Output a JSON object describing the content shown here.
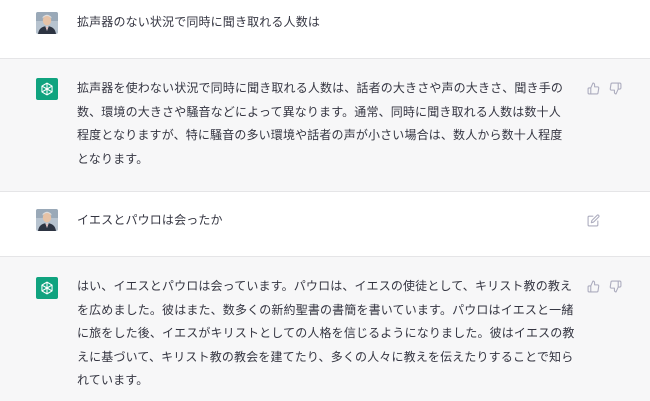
{
  "conversation": [
    {
      "role": "user",
      "avatar_icon": "user-photo-icon",
      "text": "拡声器のない状況で同時に聞き取れる人数は"
    },
    {
      "role": "assistant",
      "avatar_icon": "openai-logo-icon",
      "text": "拡声器を使わない状況で同時に聞き取れる人数は、話者の大きさや声の大きさ、聞き手の\n数、環境の大きさや騒音などによって異なります。通常、同時に聞き取れる人数は数十人\n程度となりますが、特に騒音の多い環境や話者の声が小さい場合は、数人から数十人程度\nとなります。",
      "actions": [
        "thumbs-up-icon",
        "thumbs-down-icon"
      ]
    },
    {
      "role": "user",
      "avatar_icon": "user-photo-icon",
      "text": "イエスとパウロは会ったか",
      "actions": [
        "edit-icon"
      ]
    },
    {
      "role": "assistant",
      "avatar_icon": "openai-logo-icon",
      "text": "はい、イエスとパウロは会っています。パウロは、イエスの使徒として、キリスト教の教え\nを広めました。彼はまた、数多くの新約聖書の書簡を書いています。パウロはイエスと一緒\nに旅をした後、イエスがキリストとしての人格を信じるようになりました。彼はイエスの教\nえに基づいて、キリスト教の教会を建てたり、多くの人々に教えを伝えたりすることで知ら\nれています。",
      "actions": [
        "thumbs-up-icon",
        "thumbs-down-icon"
      ]
    }
  ],
  "colors": {
    "assistant_bg": "#f7f7f8",
    "user_bg": "#ffffff",
    "brand_green": "#10a37f",
    "icon_gray": "#acacbe",
    "text": "#343541"
  }
}
